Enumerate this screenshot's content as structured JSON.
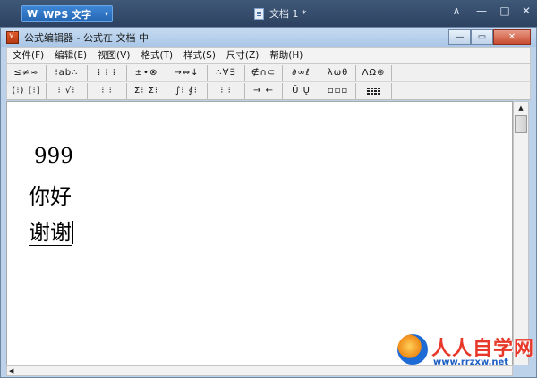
{
  "wps": {
    "app_label": "WPS 文字",
    "logo_glyph": "W",
    "dropdown_glyph": "▾",
    "doc_title": "文档 1 *",
    "controls": [
      "∧",
      "—",
      "□",
      "✕"
    ]
  },
  "editor": {
    "title": "公式编辑器 - 公式在 文档 中",
    "caption": {
      "minimize": "—",
      "maximize": "▭",
      "close": "✕"
    }
  },
  "menu": [
    "文件(F)",
    "编辑(E)",
    "视图(V)",
    "格式(T)",
    "样式(S)",
    "尺寸(Z)",
    "帮助(H)"
  ],
  "toolbar_row1": [
    "≤≠≈",
    "⁝ab∴",
    "⁞ ⁞ ⁞",
    "±•⊗",
    "→⇔↓",
    "∴∀∃",
    "∉∩⊂",
    "∂∞ℓ",
    "λωθ",
    "ΛΩ⊛"
  ],
  "toolbar_row2": [
    "(⁝) [⁝]",
    "⁝ √⁝",
    "⁝ ⁝",
    "Σ⁝ Σ⁝",
    "∫⁝ ∮⁝",
    "⁝ ⁝",
    "→ ←",
    "Ū Ų",
    "▫▫▫",
    "grid"
  ],
  "content": {
    "line1": "999",
    "line2": "你好",
    "line3": "谢谢"
  },
  "scroll": {
    "up_glyph": "▲",
    "left_glyph": "◀"
  },
  "watermark": {
    "text": "人人自学网",
    "url": "www.rrzxw.net"
  }
}
